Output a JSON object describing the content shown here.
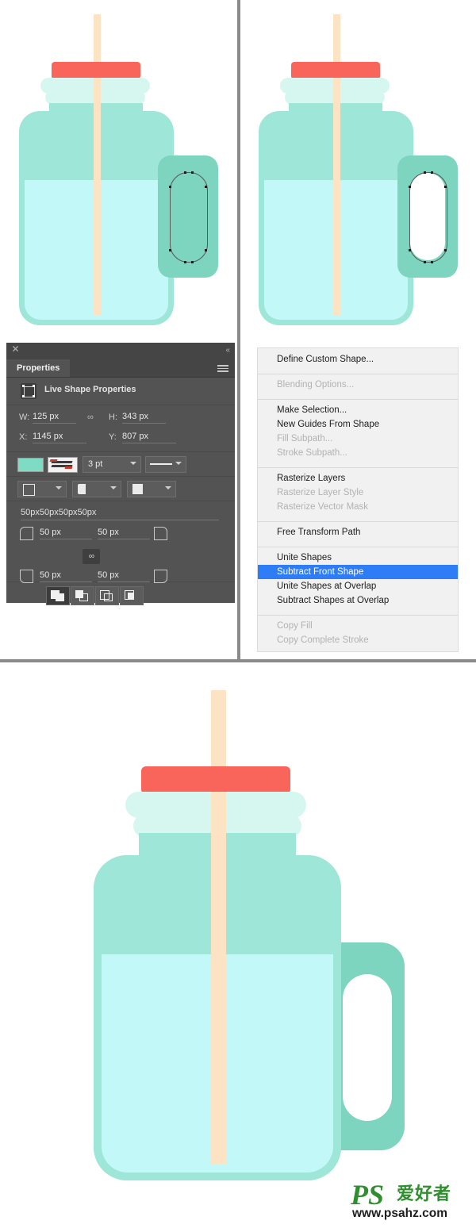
{
  "app": "Adobe Photoshop",
  "panels": {
    "properties": {
      "close_label": "✕",
      "collapse_label": "«",
      "tab_label": "Properties",
      "menu_icon": "hamburger-menu-icon",
      "section_title": "Live Shape Properties",
      "shape_icon": "live-shape-icon",
      "dimensions": {
        "w_label": "W:",
        "w_value": "125 px",
        "link_icon": "∞",
        "h_label": "H:",
        "h_value": "343 px",
        "x_label": "X:",
        "x_value": "1145 px",
        "y_label": "Y:",
        "y_value": "807 px"
      },
      "stroke": {
        "fill_swatch_color": "#7fdcc4",
        "stroke_swatch_name": "stroke-color-none-icon",
        "width_value": "3 pt",
        "line_style_name": "solid-line-icon"
      },
      "stroke_options": {
        "align_name": "stroke-align-icon",
        "caps_name": "stroke-caps-icon",
        "corners_name": "stroke-corners-icon"
      },
      "corner_radii": {
        "summary": "50px50px50px50px",
        "top_left": "50 px",
        "top_right": "50 px",
        "bottom_left": "50 px",
        "bottom_right": "50 px",
        "link_label": "∞"
      },
      "path_ops": [
        {
          "name": "unite-shapes-button",
          "active": true
        },
        {
          "name": "subtract-front-shape-button",
          "active": false
        },
        {
          "name": "intersect-shapes-button",
          "active": false
        },
        {
          "name": "exclude-overlapping-shapes-button",
          "active": false
        }
      ]
    }
  },
  "context_menu": {
    "items": [
      {
        "label": "Define Custom Shape...",
        "state": "enabled"
      },
      {
        "separator": true
      },
      {
        "label": "Blending Options...",
        "state": "disabled"
      },
      {
        "separator": true
      },
      {
        "label": "Make Selection...",
        "state": "enabled"
      },
      {
        "label": "New Guides From Shape",
        "state": "enabled"
      },
      {
        "label": "Fill Subpath...",
        "state": "disabled"
      },
      {
        "label": "Stroke Subpath...",
        "state": "disabled"
      },
      {
        "separator": true
      },
      {
        "label": "Rasterize Layers",
        "state": "enabled"
      },
      {
        "label": "Rasterize Layer Style",
        "state": "disabled"
      },
      {
        "label": "Rasterize Vector Mask",
        "state": "disabled"
      },
      {
        "separator": true
      },
      {
        "label": "Free Transform Path",
        "state": "enabled"
      },
      {
        "separator": true
      },
      {
        "label": "Unite Shapes",
        "state": "enabled"
      },
      {
        "label": "Subtract Front Shape",
        "state": "selected"
      },
      {
        "label": "Unite Shapes at Overlap",
        "state": "enabled"
      },
      {
        "label": "Subtract Shapes at Overlap",
        "state": "enabled"
      },
      {
        "separator": true
      },
      {
        "label": "Copy Fill",
        "state": "disabled"
      },
      {
        "label": "Copy Complete Stroke",
        "state": "disabled"
      }
    ]
  },
  "artwork": {
    "description": "Flat-design mason jar mug with straw, red lid, teal body, light blue liquid and rounded handle",
    "colors": {
      "jar_body": "#9ee7d8",
      "liquid": "#c2f8f8",
      "lid_red": "#f9655b",
      "ring_pale": "#d6f7ef",
      "straw": "#fbe3c4",
      "handle": "#7dd5bf",
      "background": "#ffffff",
      "divider": "#8a8a8a"
    },
    "panels": [
      {
        "name": "jar-before-subtract",
        "note": "handle with inner rounded path selected, anchors visible"
      },
      {
        "name": "jar-after-subtract",
        "note": "handle hole cut out revealing background"
      },
      {
        "name": "jar-final-result",
        "note": "finished mug with handle"
      }
    ]
  },
  "watermark": {
    "logo_text": "PS",
    "logo_cn": "爱好者",
    "url": "www.psahz.com",
    "color": "#2f8f2f"
  }
}
